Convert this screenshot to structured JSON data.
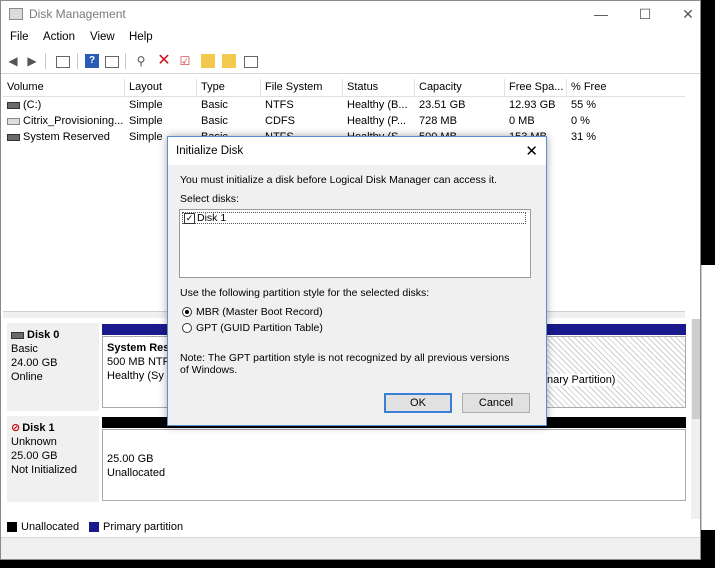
{
  "window": {
    "title": "Disk Management",
    "controls": {
      "minimize": "—",
      "maximize": "☐",
      "close": "✕"
    }
  },
  "menu": [
    "File",
    "Action",
    "View",
    "Help"
  ],
  "toolbar": {
    "icons": [
      "back-arrow-icon",
      "forward-arrow-icon",
      "disk-list-icon",
      "help-icon",
      "properties-icon",
      "connect-icon",
      "delete-icon",
      "check-icon",
      "folder-icon",
      "open-folder-icon",
      "console-icon"
    ],
    "delete_color": "#d0121b"
  },
  "volumes": {
    "columns": [
      "Volume",
      "Layout",
      "Type",
      "File System",
      "Status",
      "Capacity",
      "Free Spa...",
      "% Free"
    ],
    "rows": [
      [
        "(C:)",
        "Simple",
        "Basic",
        "NTFS",
        "Healthy (B...",
        "23.51 GB",
        "12.93 GB",
        "55 %"
      ],
      [
        "Citrix_Provisioning...",
        "Simple",
        "Basic",
        "CDFS",
        "Healthy (P...",
        "728 MB",
        "0 MB",
        "0 %"
      ],
      [
        "System Reserved",
        "Simple",
        "Basic",
        "NTFS",
        "Healthy (S...",
        "500 MB",
        "153 MB",
        "31 %"
      ]
    ]
  },
  "disks": {
    "disk0": {
      "name": "Disk 0",
      "type": "Basic",
      "size": "24.00 GB",
      "status": "Online",
      "partition1": {
        "name": "System Res",
        "size": "500 MB NTF",
        "status": "Healthy (Sy"
      },
      "partition2": {
        "status": "nary Partition)"
      }
    },
    "disk1": {
      "name": "Disk 1",
      "type": "Unknown",
      "size": "25.00 GB",
      "status": "Not Initialized",
      "unalloc": {
        "size": "25.00 GB",
        "label": "Unallocated"
      }
    }
  },
  "legend": {
    "unallocated": "Unallocated",
    "primary": "Primary partition",
    "unallocated_color": "#000000",
    "primary_color": "#1a1a8c"
  },
  "dialog": {
    "title": "Initialize Disk",
    "intro": "You must initialize a disk before Logical Disk Manager can access it.",
    "select_label": "Select disks:",
    "disks": [
      {
        "label": "Disk 1",
        "checked": true
      }
    ],
    "style_label": "Use the following partition style for the selected disks:",
    "options": [
      {
        "label": "MBR (Master Boot Record)",
        "selected": true
      },
      {
        "label": "GPT (GUID Partition Table)",
        "selected": false
      }
    ],
    "note": "Note: The GPT partition style is not recognized by all previous versions of Windows.",
    "ok": "OK",
    "cancel": "Cancel"
  }
}
